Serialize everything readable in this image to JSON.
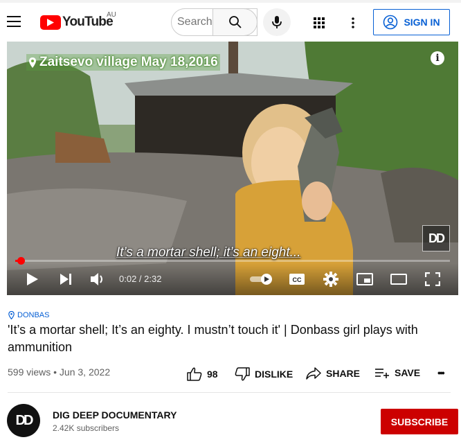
{
  "header": {
    "logo_text": "YouTube",
    "region": "AU",
    "search_placeholder": "Search",
    "signin_label": "SIGN IN"
  },
  "player": {
    "location_overlay": "Zaitsevo village May 18,2016",
    "info_glyph": "i",
    "watermark": "DD",
    "subtitle": "It’s a mortar shell; it’s an eight...",
    "current_time": "0:02",
    "duration": "2:32",
    "time_display": "0:02 / 2:32",
    "progress_fraction": 0.013,
    "cc_label": "CC"
  },
  "video": {
    "hashtag": "DONBAS",
    "title": "'It’s a mortar shell; It’s an eighty. I mustn’t touch it' | Donbass girl plays with ammunition",
    "meta": "599 views • Jun 3, 2022",
    "likes": "98",
    "dislike_label": "DISLIKE",
    "share_label": "SHARE",
    "save_label": "SAVE",
    "more_glyph": "•••"
  },
  "channel": {
    "avatar_text": "DD",
    "name": "DIG DEEP DOCUMENTARY",
    "subscribers": "2.42K subscribers",
    "subscribe_label": "SUBSCRIBE"
  },
  "colors": {
    "brand_red": "#ff0000",
    "subscribe_red": "#cc0000",
    "link_blue": "#065fd4"
  },
  "icons": [
    "menu-icon",
    "youtube-logo-icon",
    "search-icon",
    "mic-icon",
    "apps-grid-icon",
    "more-vert-icon",
    "account-circle-icon",
    "location-pin-icon",
    "info-icon",
    "play-icon",
    "skip-next-icon",
    "volume-icon",
    "autoplay-toggle-icon",
    "captions-icon",
    "settings-icon",
    "miniplayer-icon",
    "theater-icon",
    "fullscreen-icon",
    "thumb-up-icon",
    "thumb-down-icon",
    "share-icon",
    "save-playlist-icon",
    "more-horiz-icon"
  ]
}
